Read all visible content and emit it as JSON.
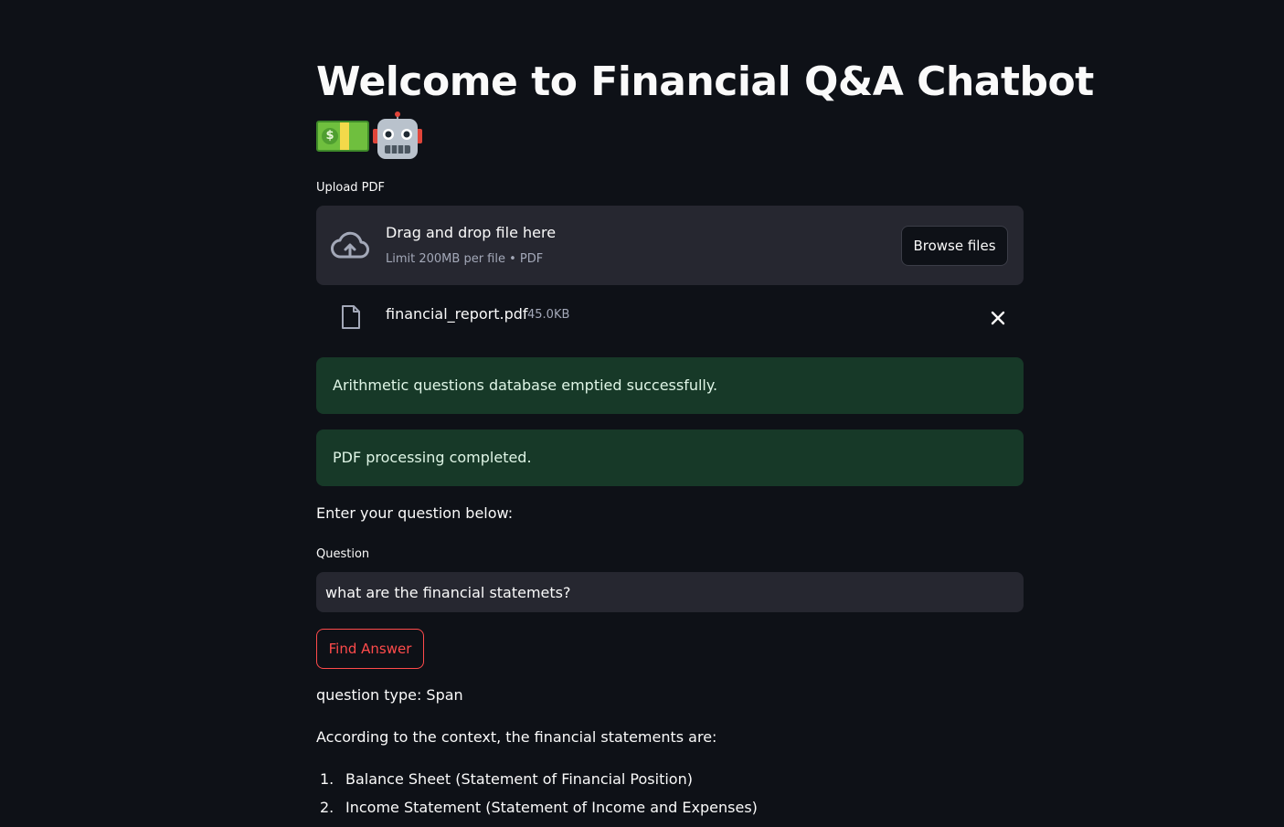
{
  "header": {
    "title": "Welcome to Financial Q&A Chatbot",
    "emoji_icons": [
      "money-icon",
      "robot-icon"
    ]
  },
  "uploader": {
    "label": "Upload PDF",
    "drop_title": "Drag and drop file here",
    "drop_subtitle": "Limit 200MB per file • PDF",
    "browse_label": "Browse files",
    "icon": "cloud-upload-icon"
  },
  "uploaded_file": {
    "name": "financial_report.pdf",
    "size": "45.0KB",
    "icon": "file-icon",
    "remove_icon": "close-icon"
  },
  "alerts": [
    {
      "text": "Arithmetic questions database emptied successfully.",
      "color": "#173928"
    },
    {
      "text": "PDF processing completed.",
      "color": "#173928"
    }
  ],
  "question_section": {
    "prompt": "Enter your question below:",
    "label": "Question",
    "value": "what are the financial statemets?",
    "button_label": "Find Answer",
    "button_color": "#ff4b4b"
  },
  "answer": {
    "question_type": "question type: Span",
    "intro": "According to the context, the financial statements are:",
    "items": [
      {
        "num": "1.",
        "text": "Balance Sheet (Statement of Financial Position)"
      },
      {
        "num": "2.",
        "text": "Income Statement (Statement of Income and Expenses)"
      }
    ]
  }
}
